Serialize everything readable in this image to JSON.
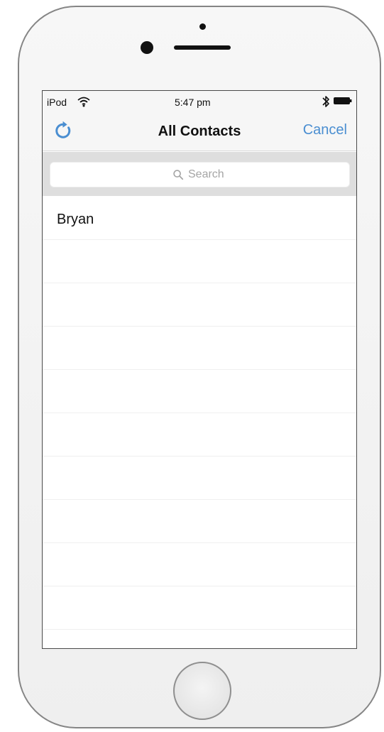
{
  "device": {
    "body_color": "#f2f2f2",
    "outline_color": "#858585",
    "front_camera_icon": "camera-dot",
    "speaker_icon": "speaker-grille",
    "home_button_icon": "home-button"
  },
  "status_bar": {
    "carrier": "iPod",
    "wifi_icon": "wifi-icon",
    "time": "5:47 pm",
    "bluetooth_icon": "bluetooth-icon",
    "battery_icon": "battery-icon"
  },
  "navigation": {
    "title": "All Contacts",
    "refresh_icon": "refresh-icon",
    "cancel_label": "Cancel",
    "accent_color": "#4a8ed1"
  },
  "search": {
    "placeholder": "Search",
    "value": "",
    "search_icon": "search-icon",
    "background_color": "#dedede"
  },
  "contacts": {
    "items": [
      {
        "name": "Bryan"
      },
      {
        "name": ""
      },
      {
        "name": ""
      },
      {
        "name": ""
      },
      {
        "name": ""
      },
      {
        "name": ""
      },
      {
        "name": ""
      },
      {
        "name": ""
      },
      {
        "name": ""
      },
      {
        "name": ""
      }
    ],
    "separator_color": "#efefef"
  }
}
